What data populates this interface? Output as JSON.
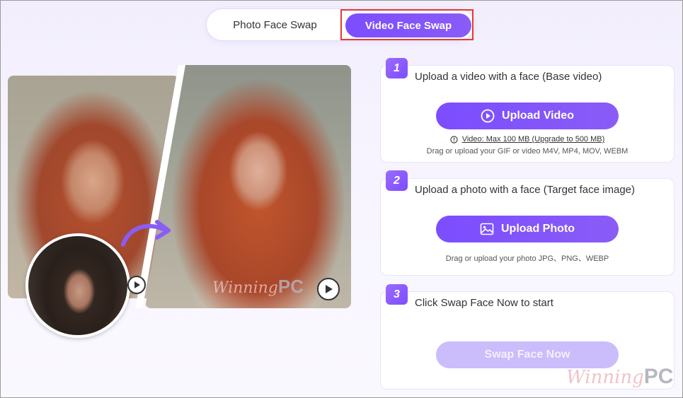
{
  "tabs": {
    "photo_label": "Photo Face Swap",
    "video_label": "Video Face Swap",
    "active": "Video Face Swap"
  },
  "steps": [
    {
      "number": "1",
      "title": "Upload a video with a face (Base video)",
      "button_label": "Upload Video",
      "limit_text": "Video: Max 100 MB (Upgrade to 500 MB)",
      "hint": "Drag or upload your GIF or video M4V, MP4, MOV, WEBM"
    },
    {
      "number": "2",
      "title": "Upload a photo with a face (Target face image)",
      "button_label": "Upload Photo",
      "hint": "Drag or upload your photo JPG、PNG、WEBP"
    },
    {
      "number": "3",
      "title": "Click Swap Face Now to start",
      "button_label": "Swap Face Now"
    }
  ],
  "watermark": {
    "script": "Winning",
    "bold": "PC"
  },
  "colors": {
    "accent": "#7c4dff",
    "accent_disabled": "#cbbcfb",
    "highlight_box": "#e53935"
  },
  "icons": {
    "upload_video": "play-circle-icon",
    "upload_photo": "image-icon",
    "limit_info": "info-circle-icon"
  }
}
